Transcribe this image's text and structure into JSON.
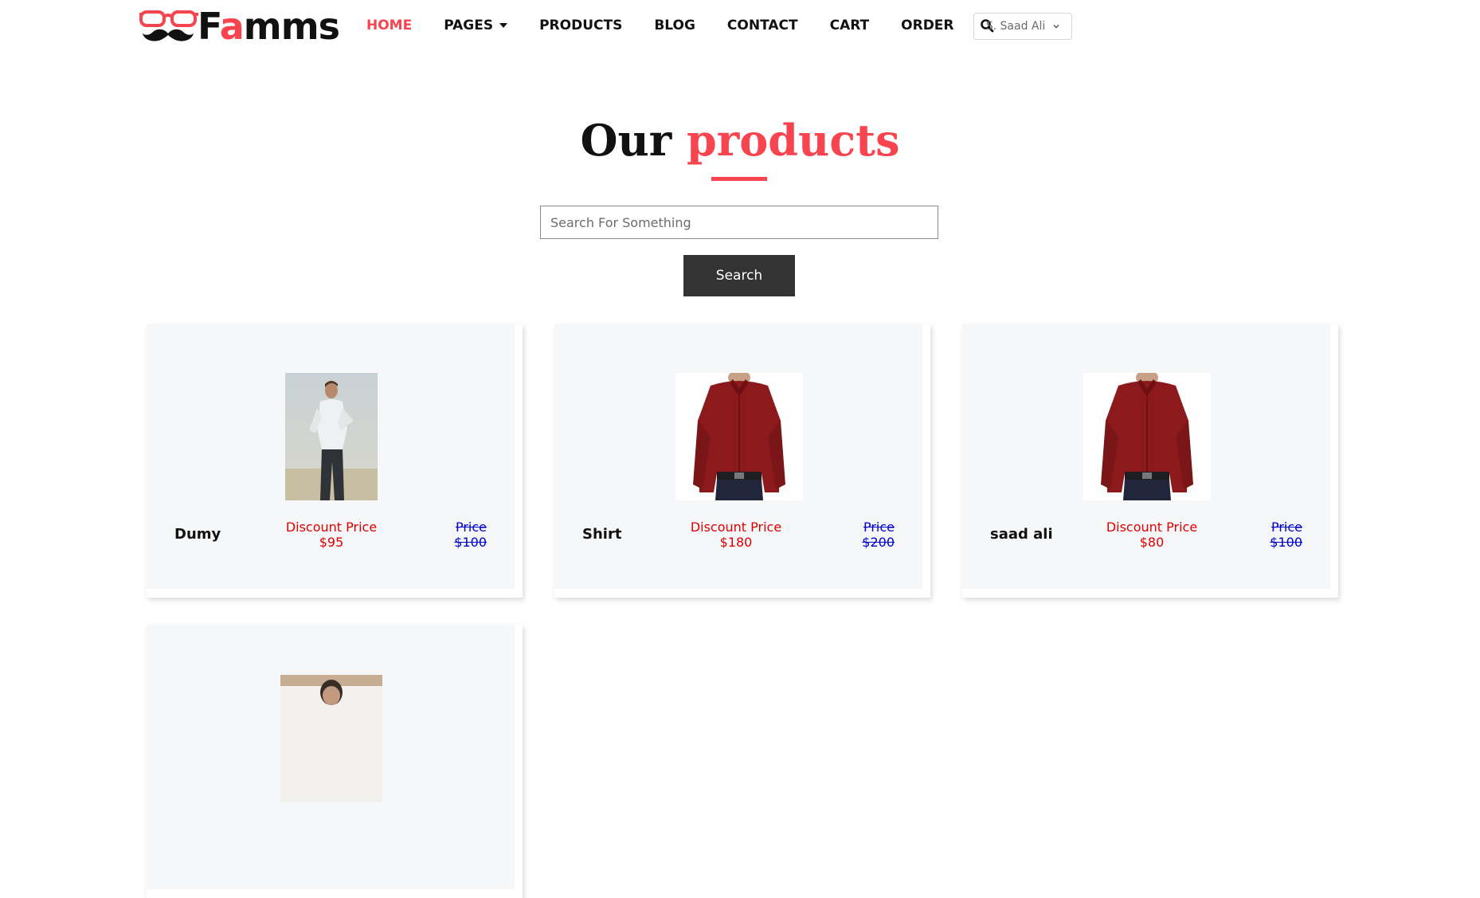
{
  "brand": {
    "name_prefix": "F",
    "name_accent": "a",
    "name_suffix": "mms",
    "accent_color": "#f7444e"
  },
  "nav": {
    "items": [
      {
        "label": "HOME",
        "active": true
      },
      {
        "label": "PAGES",
        "has_dropdown": true
      },
      {
        "label": "PRODUCTS"
      },
      {
        "label": "BLOG"
      },
      {
        "label": "CONTACT"
      },
      {
        "label": "CART"
      },
      {
        "label": "ORDER"
      }
    ],
    "search_icon": "search-icon"
  },
  "user_menu": {
    "label": "S. Saad Ali"
  },
  "page": {
    "title_main": "Our",
    "title_accent": "products"
  },
  "search": {
    "placeholder": "Search For Something",
    "button_label": "Search"
  },
  "products": [
    {
      "name": "Dumy",
      "discount_label": "Discount Price",
      "discount_price": "$95",
      "price_label": "Price",
      "price": "$100"
    },
    {
      "name": "Shirt",
      "discount_label": "Discount Price",
      "discount_price": "$180",
      "price_label": "Price",
      "price": "$200"
    },
    {
      "name": "saad ali",
      "discount_label": "Discount Price",
      "discount_price": "$80",
      "price_label": "Price",
      "price": "$100"
    }
  ],
  "colors": {
    "discount": "#e00000",
    "original_price": "#0000cc",
    "button_bg": "#333333"
  }
}
